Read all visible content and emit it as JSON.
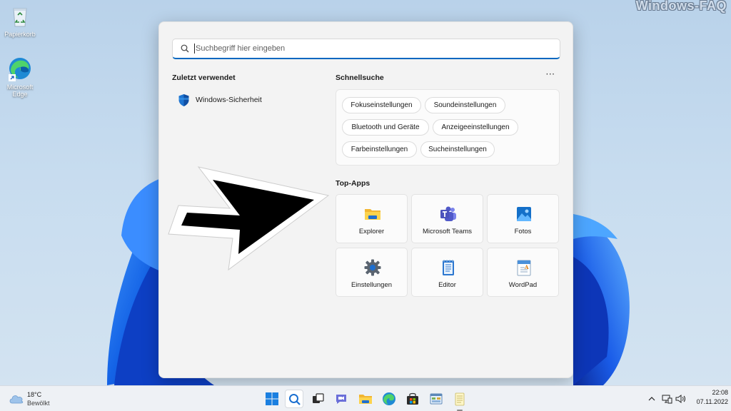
{
  "watermark": "Windows-FAQ",
  "desktop": {
    "icons": [
      {
        "label": "Papierkorb",
        "icon": "recycle-bin-icon"
      },
      {
        "label": "Microsoft Edge",
        "icon": "edge-icon"
      }
    ]
  },
  "search": {
    "placeholder": "Suchbegriff hier eingeben"
  },
  "recent": {
    "title": "Zuletzt verwendet",
    "items": [
      {
        "label": "Windows-Sicherheit",
        "icon": "shield-icon"
      }
    ]
  },
  "quick": {
    "title": "Schnellsuche",
    "more_label": "···",
    "chips": [
      "Fokuseinstellungen",
      "Soundeinstellungen",
      "Bluetooth und Geräte",
      "Anzeigeeinstellungen",
      "Farbeinstellungen",
      "Sucheinstellungen"
    ]
  },
  "top_apps": {
    "title": "Top-Apps",
    "apps": [
      {
        "label": "Explorer",
        "icon": "folder-icon"
      },
      {
        "label": "Microsoft Teams",
        "icon": "teams-icon"
      },
      {
        "label": "Fotos",
        "icon": "photos-icon"
      },
      {
        "label": "Einstellungen",
        "icon": "gear-icon"
      },
      {
        "label": "Editor",
        "icon": "notepad-icon"
      },
      {
        "label": "WordPad",
        "icon": "wordpad-icon"
      }
    ]
  },
  "taskbar": {
    "weather": {
      "temp": "18°C",
      "condition": "Bewölkt",
      "icon": "cloud-icon"
    },
    "pinned": [
      "start-icon",
      "search-icon",
      "task-view-icon",
      "chat-icon",
      "explorer-icon",
      "edge-icon",
      "store-icon",
      "control-panel-icon",
      "notepad-icon"
    ],
    "tray": {
      "time": "22:08",
      "date": "07.11.2022"
    }
  },
  "colors": {
    "accent": "#0067c0",
    "panel_bg": "#f3f3f3",
    "tile_bg": "#fbfbfb"
  }
}
